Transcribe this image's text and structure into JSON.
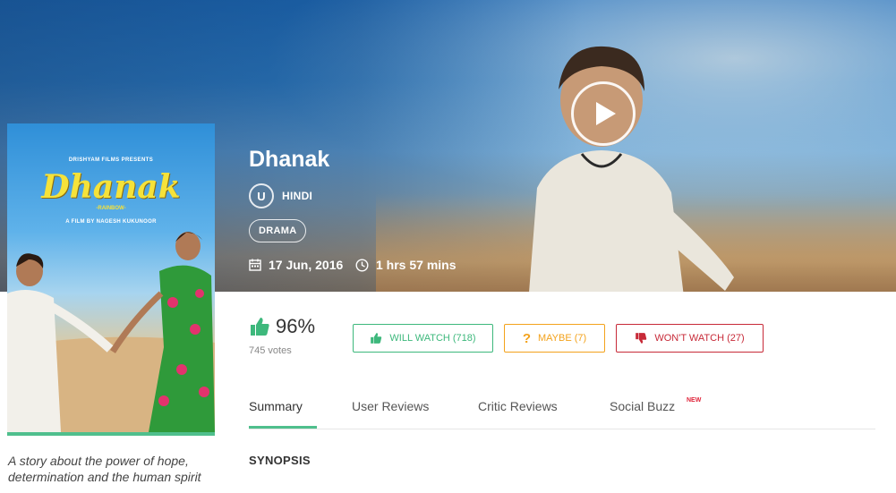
{
  "movie": {
    "title": "Dhanak",
    "certificate": "U",
    "language": "HINDI",
    "genre": "DRAMA",
    "release_date": "17 Jun, 2016",
    "duration": "1 hrs 57 mins",
    "tagline": "A story about the power of hope, determination and the human spirit"
  },
  "poster": {
    "presents": "DRISHYAM FILMS PRESENTS",
    "logo_text": "Dhanak",
    "subtitle": "-RAINBOW-",
    "director_line": "A FILM BY NAGESH KUKUNOOR"
  },
  "rating": {
    "percent": "96%",
    "votes": "745 votes"
  },
  "actions": {
    "will_watch": "WILL WATCH (718)",
    "maybe": "MAYBE (7)",
    "wont_watch": "WON'T WATCH (27)"
  },
  "tabs": {
    "summary": "Summary",
    "user_reviews": "User Reviews",
    "critic_reviews": "Critic Reviews",
    "social_buzz": "Social Buzz",
    "new_badge": "NEW"
  },
  "sections": {
    "synopsis": "SYNOPSIS"
  },
  "colors": {
    "accent_green": "#4fbf8d",
    "will_watch": "#3db87c",
    "maybe": "#f3a21b",
    "wont_watch": "#c72a38"
  },
  "icons": [
    "play-icon",
    "thumbs-up-icon",
    "thumbs-down-icon",
    "question-icon",
    "calendar-icon",
    "clock-icon"
  ]
}
